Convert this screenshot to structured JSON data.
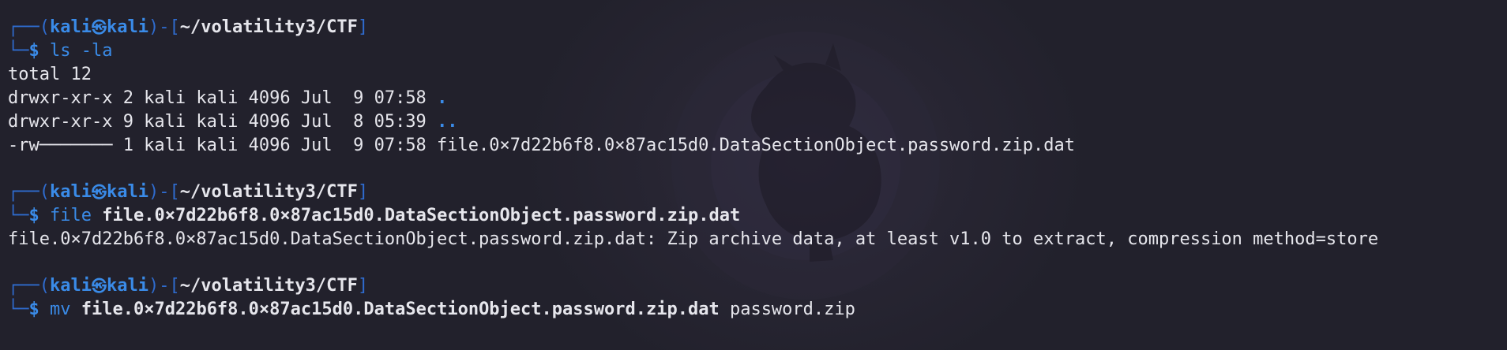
{
  "prompt": {
    "frame_top": "┌──(",
    "user": "kali",
    "at_symbol": "㉿",
    "host": "kali",
    "mid": ")-[",
    "path": "~/volatility3/CTF",
    "end": "]",
    "frame_bottom": "└─",
    "dollar": "$"
  },
  "blocks": [
    {
      "command": "ls",
      "args_plain": "-la",
      "output": [
        {
          "text": "total 12"
        },
        {
          "text": "drwxr-xr-x 2 kali kali 4096 Jul  9 07:58 ",
          "dir": "."
        },
        {
          "text": "drwxr-xr-x 9 kali kali 4096 Jul  8 05:39 ",
          "dir": ".."
        },
        {
          "text": "-rw─────── 1 kali kali 4096 Jul  9 07:58 file.0×7d22b6f8.0×87ac15d0.DataSectionObject.password.zip.dat"
        }
      ]
    },
    {
      "command": "file",
      "args_bold": "file.0×7d22b6f8.0×87ac15d0.DataSectionObject.password.zip.dat",
      "output": [
        {
          "text": "file.0×7d22b6f8.0×87ac15d0.DataSectionObject.password.zip.dat: Zip archive data, at least v1.0 to extract, compression method=store"
        }
      ]
    },
    {
      "command": "mv",
      "args_bold": "file.0×7d22b6f8.0×87ac15d0.DataSectionObject.password.zip.dat",
      "args_plain": "password.zip"
    }
  ],
  "colors": {
    "background": "#22212c",
    "prompt_blue": "#3a8be8",
    "frame_blue": "#2f6ccf",
    "text": "#e6e6ec"
  },
  "icons": [
    "kali-dragon-watermark-icon"
  ]
}
